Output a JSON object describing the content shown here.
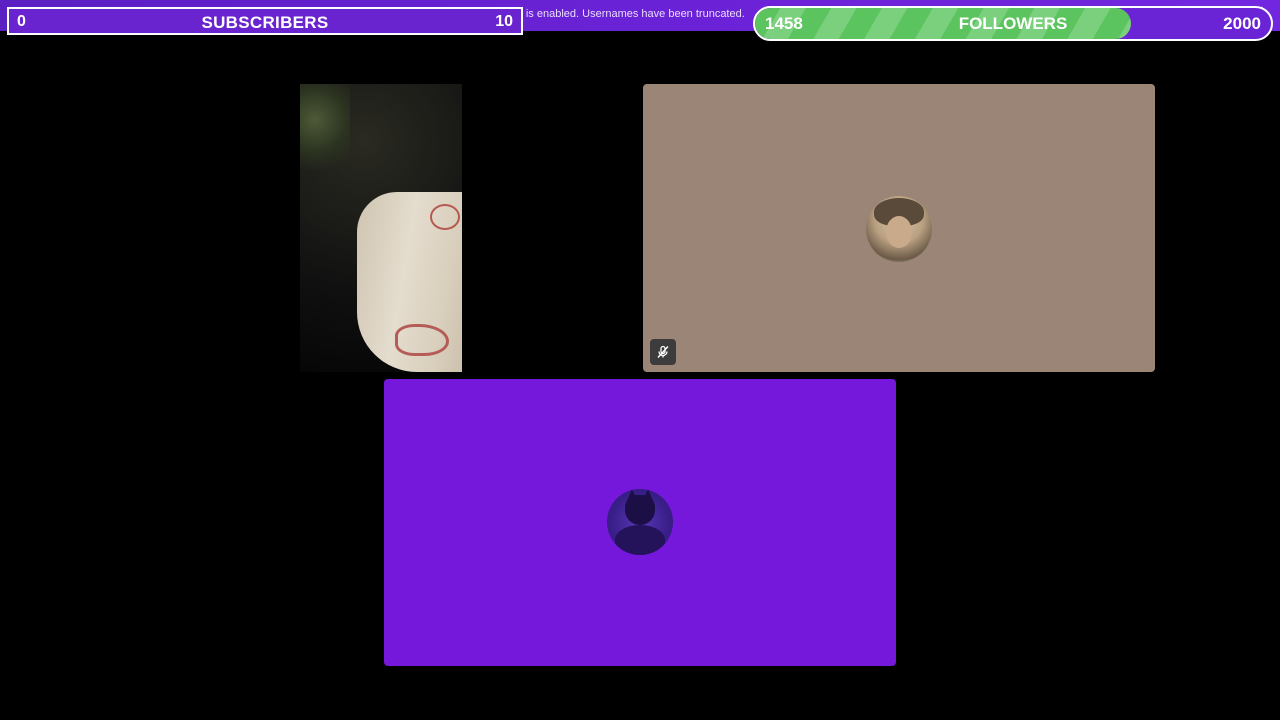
{
  "top_bar": {
    "streamer_notice": "Streamer Mode is enabled. Usernames have been truncated.",
    "close_symbol": "✕"
  },
  "subscriber_goal": {
    "current": "0",
    "label": "SUBSCRIBERS",
    "target": "10"
  },
  "follower_goal": {
    "current": "1458",
    "label": "FOLLOWERS",
    "target": "2000",
    "progress_fraction": 0.729,
    "fill_color": "#5cc45e"
  },
  "tiles": [
    {
      "kind": "camera-video"
    },
    {
      "kind": "avatar",
      "avatar": "person-photo",
      "background": "#9a8576",
      "muted": true
    },
    {
      "kind": "avatar",
      "avatar": "batman-photo",
      "background": "#7617dc"
    }
  ],
  "icons": {
    "mute": "microphone-muted-icon"
  }
}
